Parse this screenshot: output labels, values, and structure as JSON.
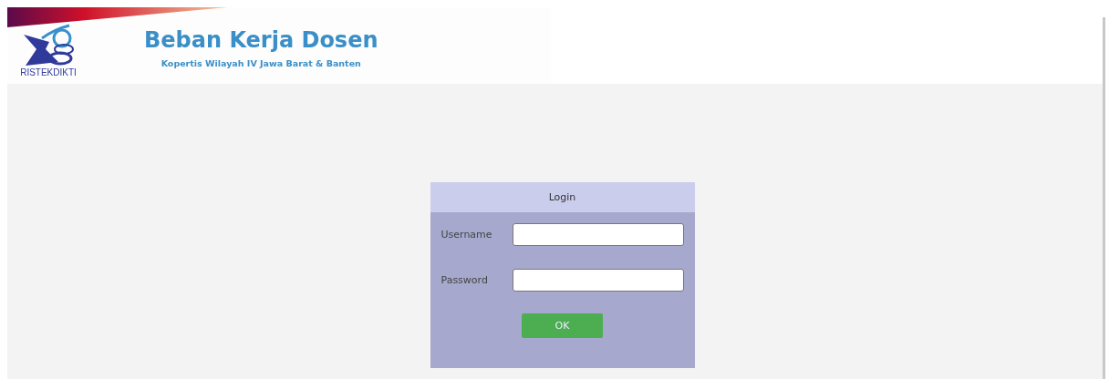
{
  "header": {
    "logo_text": "RISTEKDIKTI",
    "title": "Beban Kerja Dosen",
    "subtitle": "Kopertis Wilayah IV Jawa Barat & Banten"
  },
  "login": {
    "title": "Login",
    "fields": [
      {
        "label": "Username"
      },
      {
        "label": "Password"
      }
    ],
    "button": "OK"
  }
}
